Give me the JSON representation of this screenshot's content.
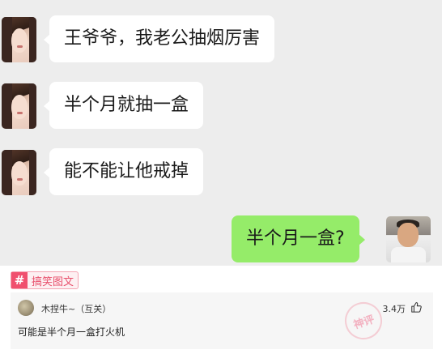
{
  "messages": [
    {
      "from": "other",
      "text": "王爷爷，我老公抽烟厉害"
    },
    {
      "from": "other",
      "text": "半个月就抽一盒"
    },
    {
      "from": "other",
      "text": "能不能让他戒掉"
    },
    {
      "from": "me",
      "text": "半个月一盒?"
    }
  ],
  "tag": {
    "icon": "#",
    "label": "搞笑图文"
  },
  "comment": {
    "user": "木捏牛~（互关）",
    "likes": "3.4万",
    "text": "可能是半个月一盒打火机"
  },
  "watermark": {
    "text": "神评"
  },
  "colors": {
    "chat_bg": "#ededed",
    "bubble_other": "#ffffff",
    "bubble_me": "#95ec69",
    "tag_accent": "#f0506e"
  }
}
